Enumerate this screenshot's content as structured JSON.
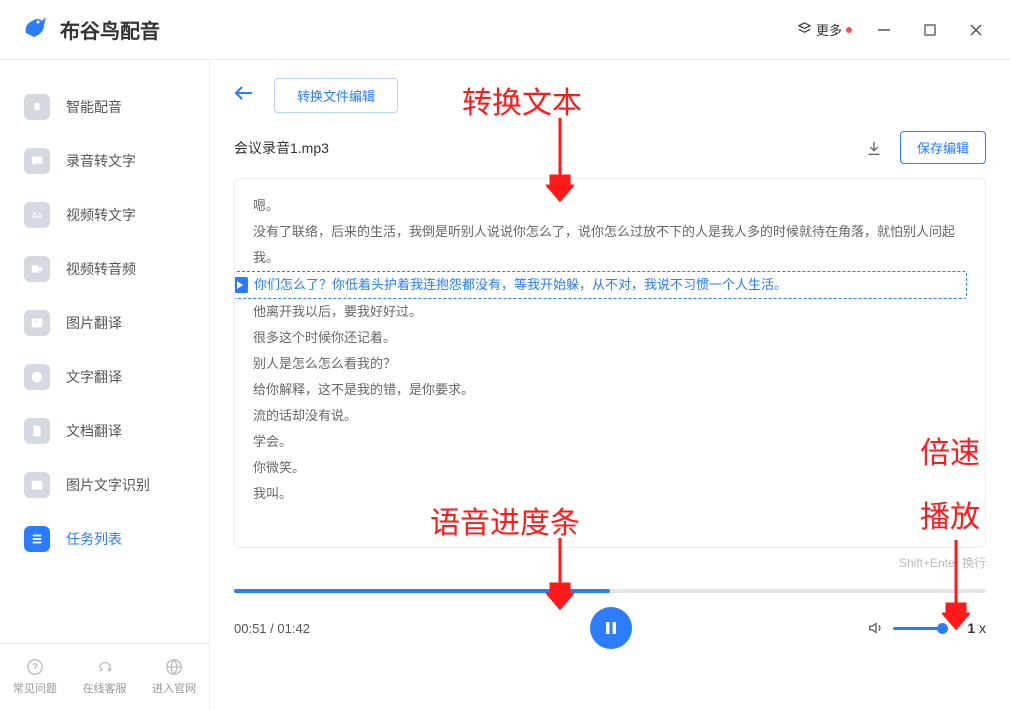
{
  "titlebar": {
    "app_name": "布谷鸟配音",
    "more_label": "更多"
  },
  "sidebar": {
    "items": [
      {
        "label": "智能配音"
      },
      {
        "label": "录音转文字"
      },
      {
        "label": "视频转文字"
      },
      {
        "label": "视频转音频"
      },
      {
        "label": "图片翻译"
      },
      {
        "label": "文字翻译"
      },
      {
        "label": "文档翻译"
      },
      {
        "label": "图片文字识别"
      },
      {
        "label": "任务列表",
        "active": true
      }
    ],
    "footer": [
      {
        "label": "常见问题"
      },
      {
        "label": "在线客服"
      },
      {
        "label": "进入官网"
      }
    ]
  },
  "topbar": {
    "mode_button": "转换文件编辑"
  },
  "file": {
    "name": "会议录音1.mp3",
    "save_button": "保存编辑"
  },
  "transcript": {
    "lines": [
      {
        "text": "嗯。"
      },
      {
        "text": "没有了联络，后来的生活，我倒是听别人说说你怎么了，说你怎么过放不下的人是我人多的时候就待在角落，就怕别人问起我。"
      },
      {
        "text": "你们怎么了？你低着头护着我连抱怨都没有，等我开始躲，从不对，我说不习惯一个人生活。",
        "current": true
      },
      {
        "text": "他离开我以后，要我好好过。"
      },
      {
        "text": "很多这个时候你还记着。"
      },
      {
        "text": "别人是怎么怎么看我的？"
      },
      {
        "text": "给你解释，这不是我的错，是你要求。"
      },
      {
        "text": "流的话却没有说。"
      },
      {
        "text": "学会。"
      },
      {
        "text": "你微笑。"
      },
      {
        "text": "我叫。"
      }
    ],
    "hint": "Shift+Enter 换行"
  },
  "player": {
    "current_time": "00:51",
    "total_time": "01:42",
    "progress_pct": 50,
    "speed": "1",
    "speed_suffix": "x"
  },
  "annotations": {
    "a1": "转换文本",
    "a2": "语音进度条",
    "a3_line1": "倍速",
    "a3_line2": "播放"
  }
}
